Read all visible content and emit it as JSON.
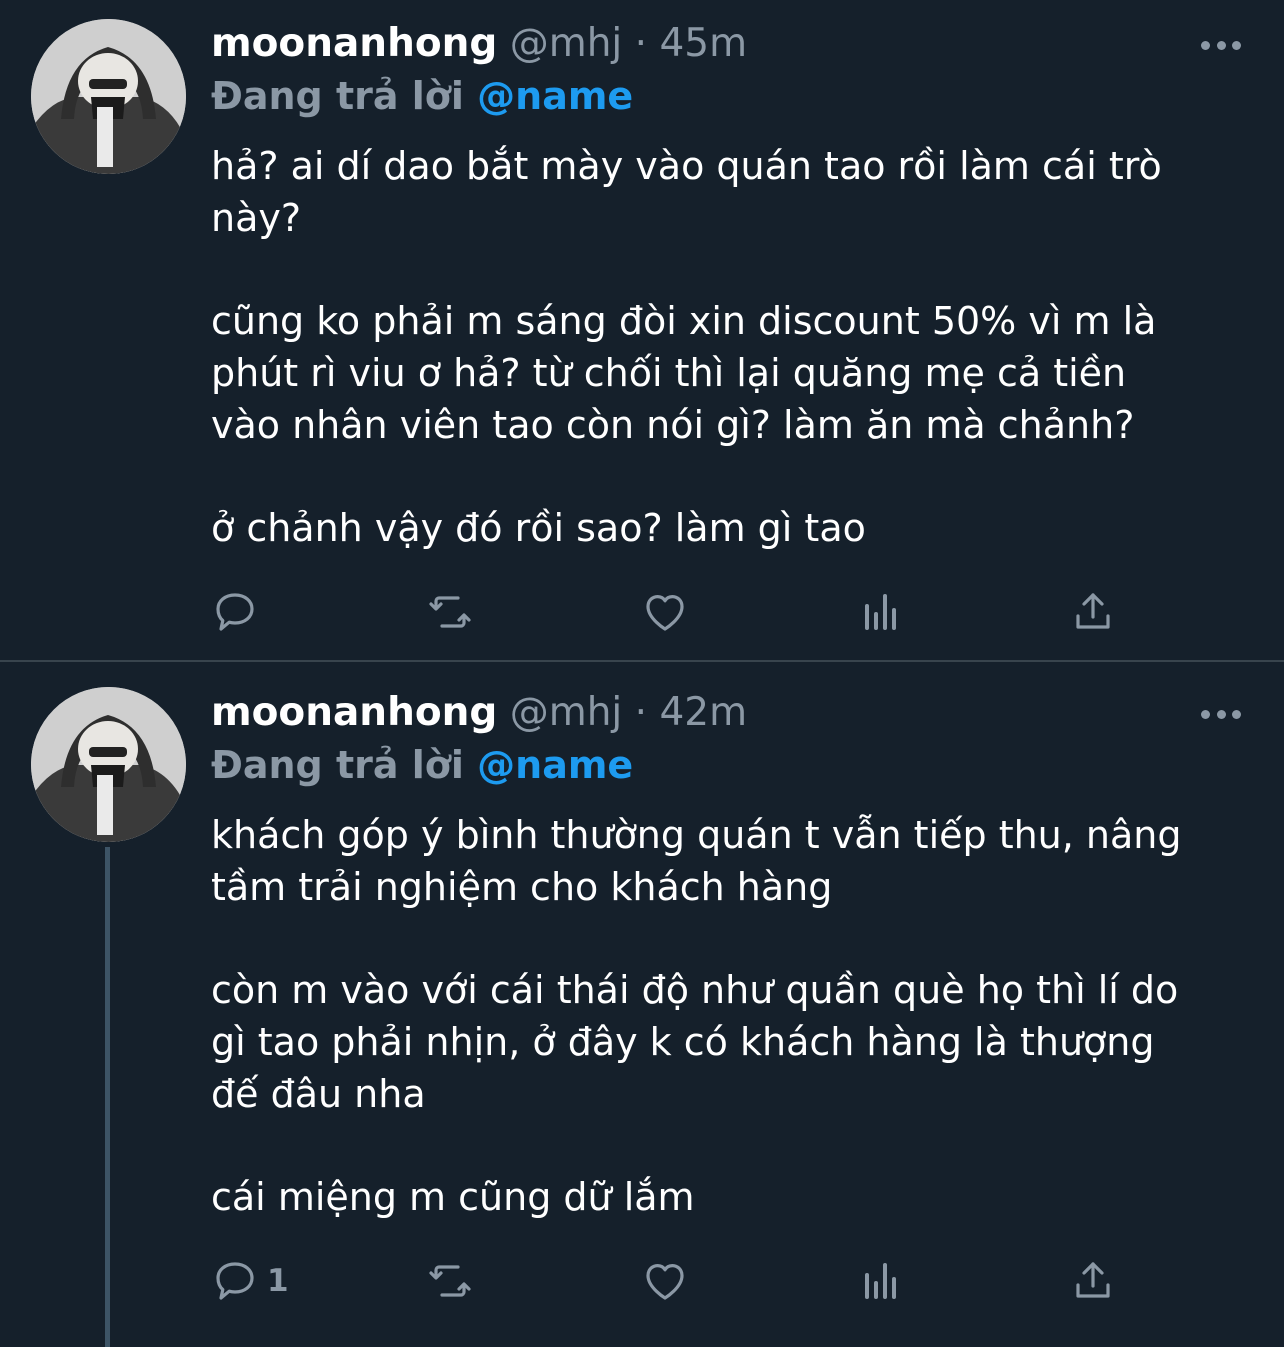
{
  "tweets": [
    {
      "display_name": "moonanhong",
      "handle": "@mhj",
      "separator": "·",
      "time": "45m",
      "replying_prefix": "Đang trả lời",
      "replying_to": "@name",
      "paragraphs": [
        "hả? ai dí dao bắt mày vào quán tao rồi làm cái trò\nnày?",
        "cũng ko phải m sáng đòi xin discount 50% vì m là\nphút rì viu ơ hả? từ chối thì lại quăng mẹ cả tiền\nvào nhân viên tao còn nói gì? làm ăn mà chảnh?",
        "ở chảnh vậy đó rồi sao? làm gì tao"
      ],
      "reply_count": ""
    },
    {
      "display_name": "moonanhong",
      "handle": "@mhj",
      "separator": "·",
      "time": "42m",
      "replying_prefix": "Đang trả lời",
      "replying_to": "@name",
      "paragraphs": [
        "khách góp ý bình thường quán t vẫn tiếp thu, nâng\ntầm trải nghiệm cho khách hàng",
        "còn m vào với cái thái độ như quần què họ thì lí do\ngì tao phải nhịn, ở đây k có khách hàng là thượng\nđế đâu nha",
        "cái miệng m cũng dữ lắm"
      ],
      "reply_count": "1"
    }
  ],
  "icons": {
    "more": "more-horizontal-icon",
    "reply": "reply-bubble-icon",
    "retweet": "retweet-icon",
    "like": "heart-icon",
    "views": "views-bar-chart-icon",
    "share": "share-upload-icon"
  },
  "colors": {
    "background": "#15202b",
    "text": "#ffffff",
    "secondary": "#8b98a5",
    "accent": "#1d9bf0",
    "divider": "#38444d",
    "thread_line": "#3d5466"
  }
}
